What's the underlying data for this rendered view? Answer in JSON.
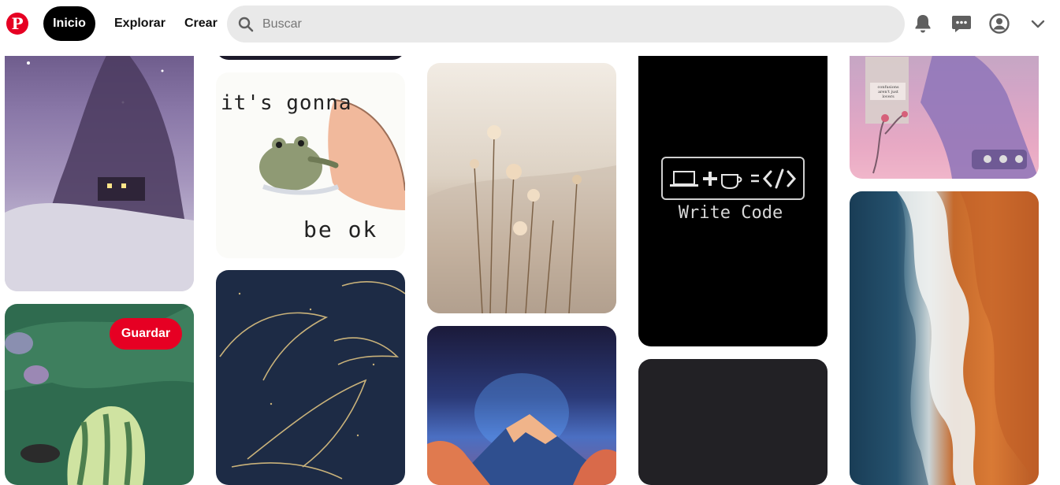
{
  "header": {
    "nav_home": "Inicio",
    "nav_explore": "Explorar",
    "nav_create": "Crear",
    "search_placeholder": "Buscar",
    "search_value": ""
  },
  "pins": {
    "save_label": "Guardar",
    "frog_text_1": "it's gonna",
    "frog_text_2": "be ok",
    "code_caption": "Write Code",
    "collage_caption": "confusions aren't just lovers"
  },
  "colors": {
    "brand": "#e60023",
    "search_bg": "#e9e9e9",
    "home_bg": "#000000"
  },
  "icons": {
    "logo": "pinterest-logo",
    "search": "search-icon",
    "notifications": "bell-icon",
    "messages": "chat-icon",
    "profile": "user-icon",
    "menu": "chevron-down-icon"
  }
}
